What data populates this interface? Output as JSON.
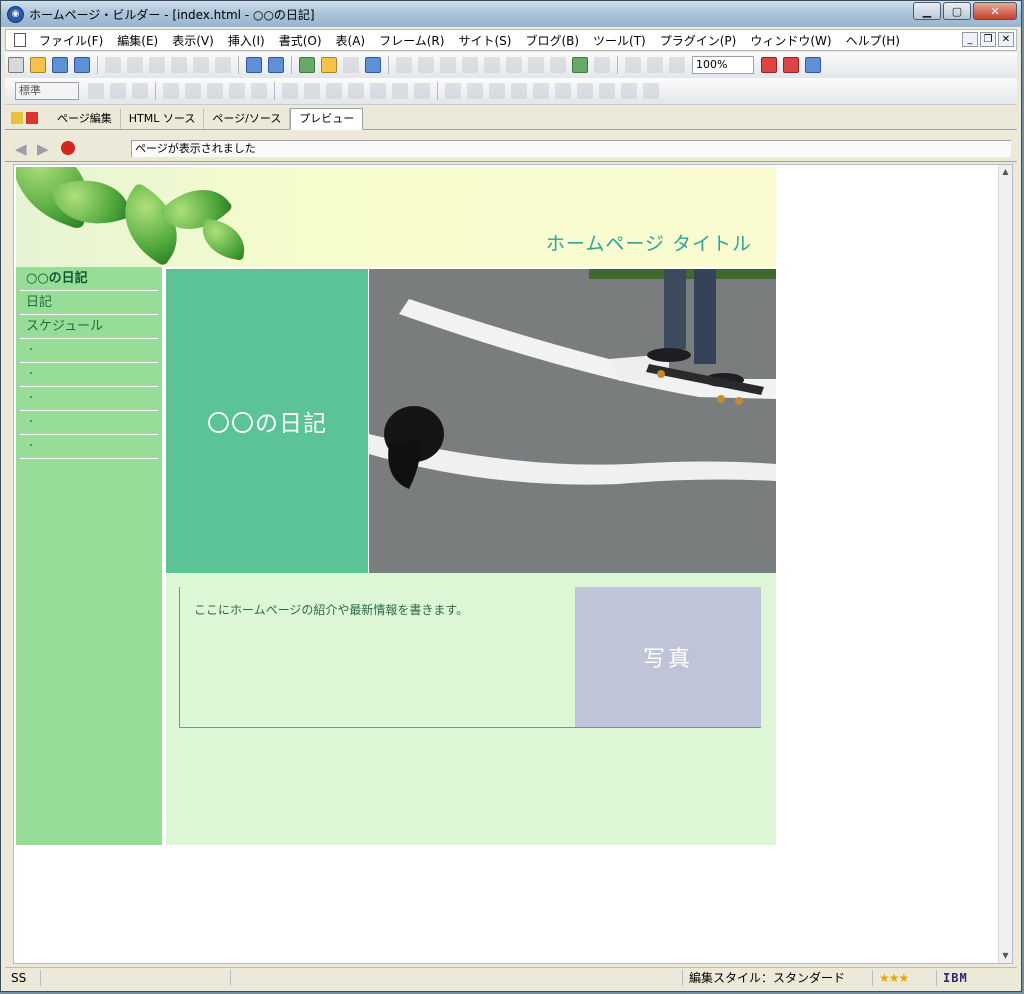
{
  "window": {
    "title": "ホームページ・ビルダー - [index.html - ○○の日記]",
    "controls": [
      "minimize-icon",
      "maximize-icon",
      "close-icon"
    ]
  },
  "menu": [
    "ファイル(F)",
    "編集(E)",
    "表示(V)",
    "挿入(I)",
    "書式(O)",
    "表(A)",
    "フレーム(R)",
    "サイト(S)",
    "ブログ(B)",
    "ツール(T)",
    "プラグイン(P)",
    "ウィンドウ(W)",
    "ヘルプ(H)"
  ],
  "toolbar": {
    "zoom": "100%",
    "style": "標準"
  },
  "tabs": [
    "ページ編集",
    "HTML ソース",
    "ページ/ソース",
    "プレビュー"
  ],
  "navbar": {
    "status_message": "ページが表示されました"
  },
  "site": {
    "title": "ホームページ タイトル",
    "nav": [
      "○○の日記",
      "日記",
      "スケジュール",
      "・",
      "・",
      "・",
      "・",
      "・"
    ],
    "hero_text": "〇〇の日記",
    "intro": "ここにホームページの紹介や最新情報を書きます。",
    "photo_label": "写真"
  },
  "statusbar": {
    "left": "SS",
    "edit_style": "編集スタイル：スタンダード",
    "stars": "★★★",
    "brand": "IBM"
  },
  "colors": {
    "sidebar": "#97dc97",
    "hero": "#5bc395",
    "content": "#ddf7d6",
    "photo_placeholder": "#bfc4d8",
    "site_title": "#2fa39a"
  }
}
